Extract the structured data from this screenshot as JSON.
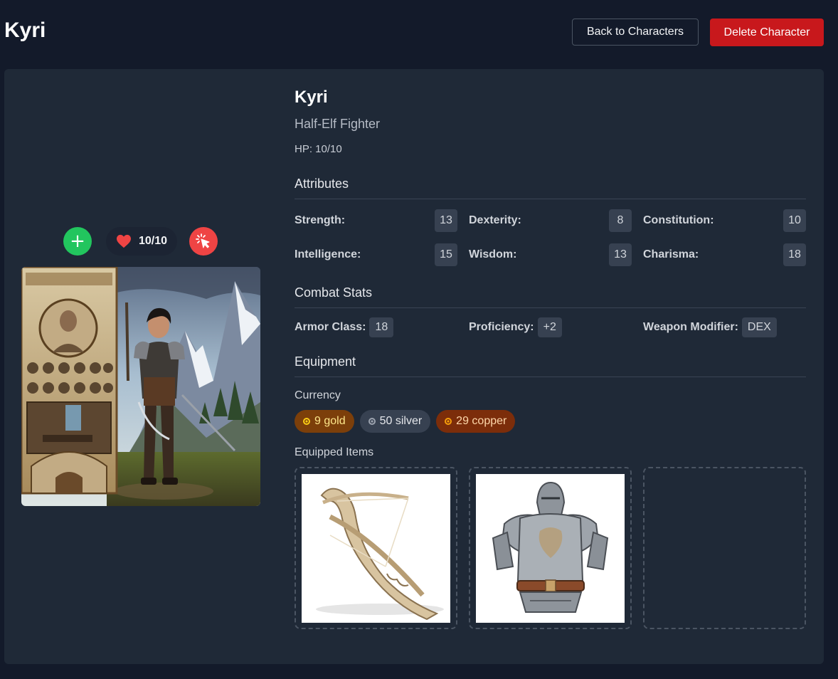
{
  "header": {
    "title": "Kyri",
    "back_label": "Back to Characters",
    "delete_label": "Delete Character"
  },
  "hp_controls": {
    "display": "10/10",
    "heal_icon": "plus-icon",
    "damage_icon": "attack-cursor-icon"
  },
  "character": {
    "name": "Kyri",
    "subtitle": "Half-Elf Fighter",
    "hp_text": "HP: 10/10"
  },
  "attributes": {
    "title": "Attributes",
    "items": [
      {
        "label": "Strength:",
        "value": "13"
      },
      {
        "label": "Dexterity:",
        "value": "8"
      },
      {
        "label": "Constitution:",
        "value": "10"
      },
      {
        "label": "Intelligence:",
        "value": "15"
      },
      {
        "label": "Wisdom:",
        "value": "13"
      },
      {
        "label": "Charisma:",
        "value": "18"
      }
    ]
  },
  "combat": {
    "title": "Combat Stats",
    "armor_label": "Armor Class:",
    "armor_value": "18",
    "prof_label": "Proficiency:",
    "prof_value": "+2",
    "weapon_label": "Weapon Modifier:",
    "weapon_value": "DEX"
  },
  "equipment": {
    "title": "Equipment",
    "currency_label": "Currency",
    "currency": {
      "gold": "9 gold",
      "silver": "50 silver",
      "copper": "29 copper"
    },
    "items_label": "Equipped Items",
    "slots": [
      {
        "item": "crossbow-image"
      },
      {
        "item": "plate-armor-image"
      },
      {
        "item": ""
      }
    ]
  },
  "colors": {
    "background": "#131a2a",
    "card": "#1f2937",
    "danger": "#c8181c",
    "heal": "#22c55e",
    "damage": "#ef4444",
    "gold_chip": "#7c3f0a",
    "copper_chip": "#7c2d0a"
  }
}
